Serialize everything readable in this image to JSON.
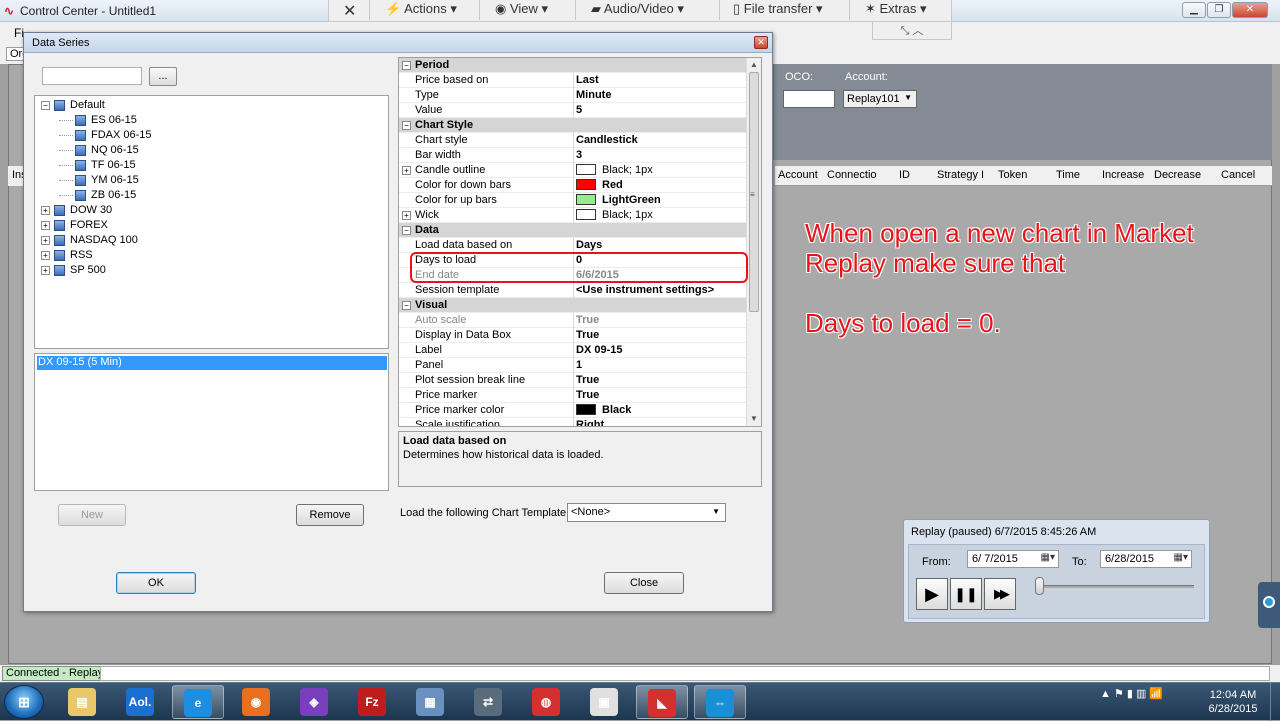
{
  "control_center": {
    "title": "Control Center - Untitled1",
    "menu_text": "Fi",
    "orders_tab": "Ord",
    "ins_tab": "Ins",
    "oco_label": "OCO:",
    "account_label": "Account:",
    "account_value": "Replay101",
    "grid_columns": [
      "Account",
      "Connectio",
      "ID",
      "Strategy I",
      "Token",
      "Time",
      "Increase",
      "Decrease",
      "Cancel"
    ]
  },
  "toolbar": {
    "close": "✕",
    "actions": "Actions",
    "view": "View",
    "audio_video": "Audio/Video",
    "file_transfer": "File transfer",
    "extras": "Extras",
    "sub": "⤡ ︿"
  },
  "dialog": {
    "title": "Data Series",
    "search_placeholder": "",
    "search_button": "...",
    "tree": [
      {
        "label": "Default",
        "expanded": true,
        "level": 0
      },
      {
        "label": "ES 06-15",
        "level": 1
      },
      {
        "label": "FDAX 06-15",
        "level": 1
      },
      {
        "label": "NQ 06-15",
        "level": 1
      },
      {
        "label": "TF 06-15",
        "level": 1
      },
      {
        "label": "YM 06-15",
        "level": 1
      },
      {
        "label": "ZB 06-15",
        "level": 1
      },
      {
        "label": "DOW 30",
        "expanded": false,
        "level": 0
      },
      {
        "label": "FOREX",
        "expanded": false,
        "level": 0
      },
      {
        "label": "NASDAQ 100",
        "expanded": false,
        "level": 0
      },
      {
        "label": "RSS",
        "expanded": false,
        "level": 0
      },
      {
        "label": "SP 500",
        "expanded": false,
        "level": 0
      }
    ],
    "selected_series": "DX 09-15 (5 Min)",
    "new_button": "New",
    "remove_button": "Remove",
    "ok_button": "OK",
    "close_button": "Close",
    "template_label": "Load the following Chart Template:",
    "template_value": "<None>",
    "description_title": "Load data based on",
    "description_text": "Determines how historical data is loaded."
  },
  "properties": [
    {
      "type": "cat",
      "label": "Period"
    },
    {
      "label": "Price based on",
      "value": "Last"
    },
    {
      "label": "Type",
      "value": "Minute"
    },
    {
      "label": "Value",
      "value": "5"
    },
    {
      "type": "cat",
      "label": "Chart Style"
    },
    {
      "label": "Chart style",
      "value": "Candlestick"
    },
    {
      "label": "Bar width",
      "value": "3"
    },
    {
      "label": "Candle outline",
      "value": "Black; 1px",
      "expand": true,
      "swatch": "#ffffff",
      "normal": true
    },
    {
      "label": "Color for down bars",
      "value": "Red",
      "swatch": "#ff0000"
    },
    {
      "label": "Color for up bars",
      "value": "LightGreen",
      "swatch": "#90ee90"
    },
    {
      "label": "Wick",
      "value": "Black; 1px",
      "expand": true,
      "swatch": "#ffffff",
      "normal": true
    },
    {
      "type": "cat",
      "label": "Data"
    },
    {
      "label": "Load data based on",
      "value": "Days"
    },
    {
      "label": "Days to load",
      "value": "0"
    },
    {
      "label": "End date",
      "value": "6/6/2015",
      "dim": true
    },
    {
      "label": "Session template",
      "value": "<Use instrument settings>"
    },
    {
      "type": "cat",
      "label": "Visual"
    },
    {
      "label": "Auto scale",
      "value": "True",
      "dim": true
    },
    {
      "label": "Display in Data Box",
      "value": "True"
    },
    {
      "label": "Label",
      "value": "DX 09-15"
    },
    {
      "label": "Panel",
      "value": "1"
    },
    {
      "label": "Plot session break line",
      "value": "True"
    },
    {
      "label": "Price marker",
      "value": "True"
    },
    {
      "label": "Price marker color",
      "value": "Black",
      "swatch": "#000000"
    },
    {
      "label": "Scale justification",
      "value": "Right"
    }
  ],
  "annotation": {
    "line1": "When open a new chart in Market",
    "line2": "Replay make sure that",
    "line3": "Days to load = 0."
  },
  "replay": {
    "title": "Replay (paused) 6/7/2015 8:45:26 AM",
    "from_label": "From:",
    "from_value": "6/  7/2015",
    "to_label": "To:",
    "to_value": "6/28/2015",
    "play": "▶",
    "pause": "❚❚",
    "fast_forward": "▶▶"
  },
  "status": {
    "connection": "Connected - Replay"
  },
  "taskbar": {
    "start": "⊞",
    "apps": [
      {
        "label": "▤",
        "color": "#e8c86a"
      },
      {
        "label": "Aol.",
        "color": "#1a6fd1"
      },
      {
        "label": "e",
        "color": "#1e8fe0",
        "active": true
      },
      {
        "label": "◉",
        "color": "#e8701f"
      },
      {
        "label": "◈",
        "color": "#7a3fbf"
      },
      {
        "label": "Fz",
        "color": "#bf1d1d"
      },
      {
        "label": "▦",
        "color": "#6a90c0"
      },
      {
        "label": "⇄",
        "color": "#5a6b7c"
      },
      {
        "label": "◍",
        "color": "#d43030"
      },
      {
        "label": "▣",
        "color": "#e0e0e0"
      },
      {
        "label": "◣",
        "color": "#d43030",
        "active": true
      },
      {
        "label": "⇔",
        "color": "#1a8fd6",
        "active": true
      }
    ],
    "tray": "▲  ⚑  ▮  ▥  📶",
    "time": "12:04 AM",
    "date": "6/28/2015"
  }
}
